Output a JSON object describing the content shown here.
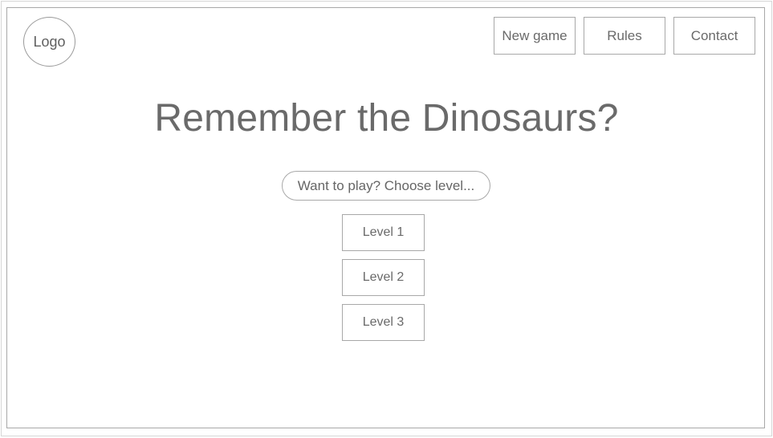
{
  "header": {
    "logo_label": "Logo",
    "nav": {
      "new_game": "New game",
      "rules": "Rules",
      "contact": "Contact"
    }
  },
  "main": {
    "title": "Remember the Dinosaurs?",
    "choose_prompt": "Want to play? Choose level...",
    "levels": [
      "Level 1",
      "Level 2",
      "Level 3"
    ]
  },
  "colors": {
    "border": "#a8a8a8",
    "text": "#6a6a6a",
    "background": "#ffffff"
  }
}
